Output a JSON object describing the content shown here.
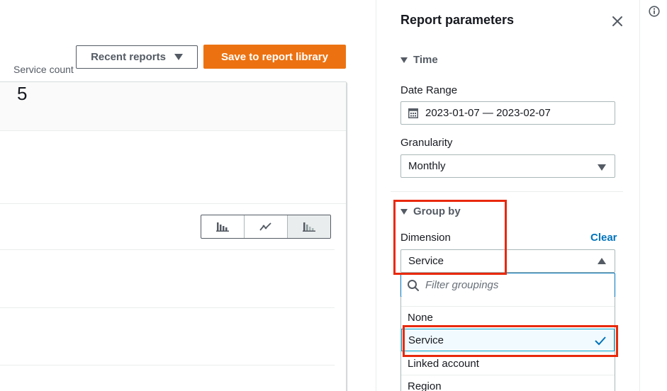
{
  "header": {
    "recent_reports_label": "Recent reports",
    "save_label": "Save to report library"
  },
  "summary": {
    "metric_label": "Service count",
    "metric_value": "5"
  },
  "chart_toggle": {
    "options": [
      "bar-chart-icon",
      "line-chart-icon",
      "stacked-bar-chart-icon"
    ],
    "active": "stacked-bar-chart-icon"
  },
  "panel": {
    "title": "Report parameters",
    "time": {
      "section_label": "Time",
      "date_range_label": "Date Range",
      "date_range_value": "2023-01-07 — 2023-02-07",
      "granularity_label": "Granularity",
      "granularity_value": "Monthly"
    },
    "group_by": {
      "section_label": "Group by",
      "dimension_label": "Dimension",
      "clear_label": "Clear",
      "dimension_value": "Service",
      "filter_placeholder": "Filter groupings",
      "options": [
        "None",
        "Service",
        "Linked account",
        "Region"
      ],
      "selected": "Service"
    }
  },
  "colors": {
    "primary_orange": "#ec7211",
    "link_blue": "#0073bb",
    "highlight_red": "#e8290b"
  }
}
